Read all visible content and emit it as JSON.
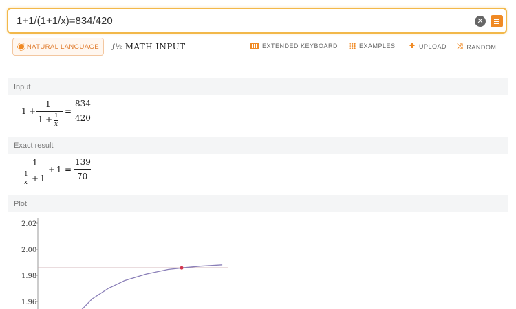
{
  "search": {
    "query": "1+1/(1+1/x)=834/420"
  },
  "modes": {
    "natural": "NATURAL LANGUAGE",
    "math": "MATH INPUT"
  },
  "toolbar": {
    "keyboard": "EXTENDED KEYBOARD",
    "examples": "EXAMPLES",
    "upload": "UPLOAD",
    "random": "RANDOM"
  },
  "pods": {
    "input": {
      "title": "Input",
      "one": "1",
      "plus": "+",
      "num": "1",
      "one_b": "1",
      "plus_b": "+",
      "inner_num": "1",
      "inner_den": "x",
      "eq": "=",
      "rhs_num": "834",
      "rhs_den": "420"
    },
    "exact": {
      "title": "Exact result",
      "num": "1",
      "inner_num": "1",
      "inner_den": "x",
      "plus_inner": "+",
      "one_inner": "1",
      "plus": "+",
      "one": "1",
      "eq": "=",
      "rhs_num": "139",
      "rhs_den": "70"
    },
    "plot": {
      "title": "Plot"
    }
  },
  "colors": {
    "accent": "#f08a24",
    "curve": "#8a7fb8",
    "hline": "#c9a0a8",
    "point": "#d2364f"
  },
  "chart_data": {
    "type": "line",
    "title": "",
    "xlabel": "",
    "ylabel": "",
    "yticks": [
      "2.02",
      "2.00",
      "1.98",
      "1.96"
    ],
    "ylim": [
      1.95,
      2.025
    ],
    "series": [
      {
        "kind": "curve",
        "points": [
          [
            0.36,
            1.95
          ],
          [
            0.5,
            1.962
          ],
          [
            0.65,
            1.97
          ],
          [
            0.8,
            1.976
          ],
          [
            1.0,
            1.981
          ],
          [
            1.2,
            1.9845
          ],
          [
            1.33,
            1.9857
          ],
          [
            1.5,
            1.987
          ],
          [
            1.7,
            1.988
          ]
        ]
      },
      {
        "kind": "hline",
        "y": 1.9857
      }
    ],
    "points": [
      [
        1.3256,
        1.9857
      ]
    ],
    "grid": false
  },
  "icons": {
    "clear": "clear-icon",
    "go": "menu-icon",
    "natural": "sun-icon",
    "math": "math-input-icon",
    "keyboard": "keyboard-icon",
    "examples": "grid-icon",
    "upload": "upload-icon",
    "random": "shuffle-icon"
  }
}
